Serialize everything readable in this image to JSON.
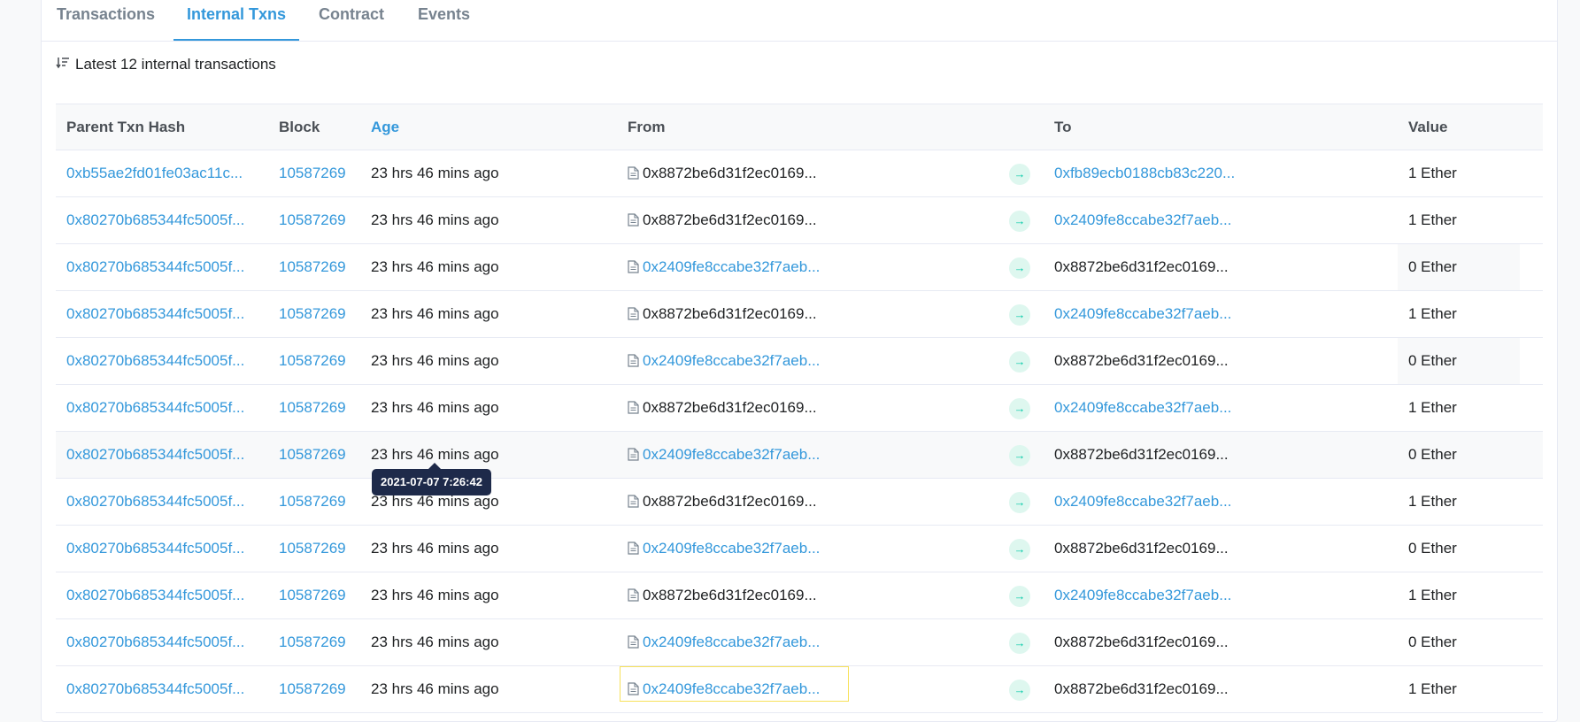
{
  "tabs": [
    {
      "label": "Transactions",
      "active": false
    },
    {
      "label": "Internal Txns",
      "active": true
    },
    {
      "label": "Contract",
      "active": false
    },
    {
      "label": "Events",
      "active": false
    }
  ],
  "summary": "Latest 12 internal transactions",
  "columns": {
    "hash": "Parent Txn Hash",
    "block": "Block",
    "age": "Age",
    "from": "From",
    "to": "To",
    "value": "Value"
  },
  "tooltip": "2021-07-07 7:26:42",
  "rows": [
    {
      "hash": "0xb55ae2fd01fe03ac11c...",
      "block": "10587269",
      "age": "23 hrs 46 mins ago",
      "from": "0x8872be6d31f2ec0169...",
      "from_link": false,
      "to": "0xfb89ecb0188cb83c220...",
      "to_link": true,
      "value": "1 Ether",
      "shaded": false
    },
    {
      "hash": "0x80270b685344fc5005f...",
      "block": "10587269",
      "age": "23 hrs 46 mins ago",
      "from": "0x8872be6d31f2ec0169...",
      "from_link": false,
      "to": "0x2409fe8ccabe32f7aeb...",
      "to_link": true,
      "value": "1 Ether",
      "shaded": false
    },
    {
      "hash": "0x80270b685344fc5005f...",
      "block": "10587269",
      "age": "23 hrs 46 mins ago",
      "from": "0x2409fe8ccabe32f7aeb...",
      "from_link": true,
      "to": "0x8872be6d31f2ec0169...",
      "to_link": false,
      "value": "0 Ether",
      "shaded": true
    },
    {
      "hash": "0x80270b685344fc5005f...",
      "block": "10587269",
      "age": "23 hrs 46 mins ago",
      "from": "0x8872be6d31f2ec0169...",
      "from_link": false,
      "to": "0x2409fe8ccabe32f7aeb...",
      "to_link": true,
      "value": "1 Ether",
      "shaded": false
    },
    {
      "hash": "0x80270b685344fc5005f...",
      "block": "10587269",
      "age": "23 hrs 46 mins ago",
      "from": "0x2409fe8ccabe32f7aeb...",
      "from_link": true,
      "to": "0x8872be6d31f2ec0169...",
      "to_link": false,
      "value": "0 Ether",
      "shaded": true
    },
    {
      "hash": "0x80270b685344fc5005f...",
      "block": "10587269",
      "age": "23 hrs 46 mins ago",
      "from": "0x8872be6d31f2ec0169...",
      "from_link": false,
      "to": "0x2409fe8ccabe32f7aeb...",
      "to_link": true,
      "value": "1 Ether",
      "shaded": false
    },
    {
      "hash": "0x80270b685344fc5005f...",
      "block": "10587269",
      "age": "23 hrs 46 mins ago",
      "from": "0x2409fe8ccabe32f7aeb...",
      "from_link": true,
      "to": "0x8872be6d31f2ec0169...",
      "to_link": false,
      "value": "0 Ether",
      "shaded": false
    },
    {
      "hash": "0x80270b685344fc5005f...",
      "block": "10587269",
      "age": "23 hrs 46 mins ago",
      "from": "0x8872be6d31f2ec0169...",
      "from_link": false,
      "to": "0x2409fe8ccabe32f7aeb...",
      "to_link": true,
      "value": "1 Ether",
      "shaded": false
    },
    {
      "hash": "0x80270b685344fc5005f...",
      "block": "10587269",
      "age": "23 hrs 46 mins ago",
      "from": "0x2409fe8ccabe32f7aeb...",
      "from_link": true,
      "to": "0x8872be6d31f2ec0169...",
      "to_link": false,
      "value": "0 Ether",
      "shaded": false
    },
    {
      "hash": "0x80270b685344fc5005f...",
      "block": "10587269",
      "age": "23 hrs 46 mins ago",
      "from": "0x8872be6d31f2ec0169...",
      "from_link": false,
      "to": "0x2409fe8ccabe32f7aeb...",
      "to_link": true,
      "value": "1 Ether",
      "shaded": false
    },
    {
      "hash": "0x80270b685344fc5005f...",
      "block": "10587269",
      "age": "23 hrs 46 mins ago",
      "from": "0x2409fe8ccabe32f7aeb...",
      "from_link": true,
      "to": "0x8872be6d31f2ec0169...",
      "to_link": false,
      "value": "0 Ether",
      "shaded": false
    },
    {
      "hash": "0x80270b685344fc5005f...",
      "block": "10587269",
      "age": "23 hrs 46 mins ago",
      "from": "0x2409fe8ccabe32f7aeb...",
      "from_link": true,
      "to": "0x8872be6d31f2ec0169...",
      "to_link": false,
      "value": "1 Ether",
      "shaded": false
    }
  ]
}
